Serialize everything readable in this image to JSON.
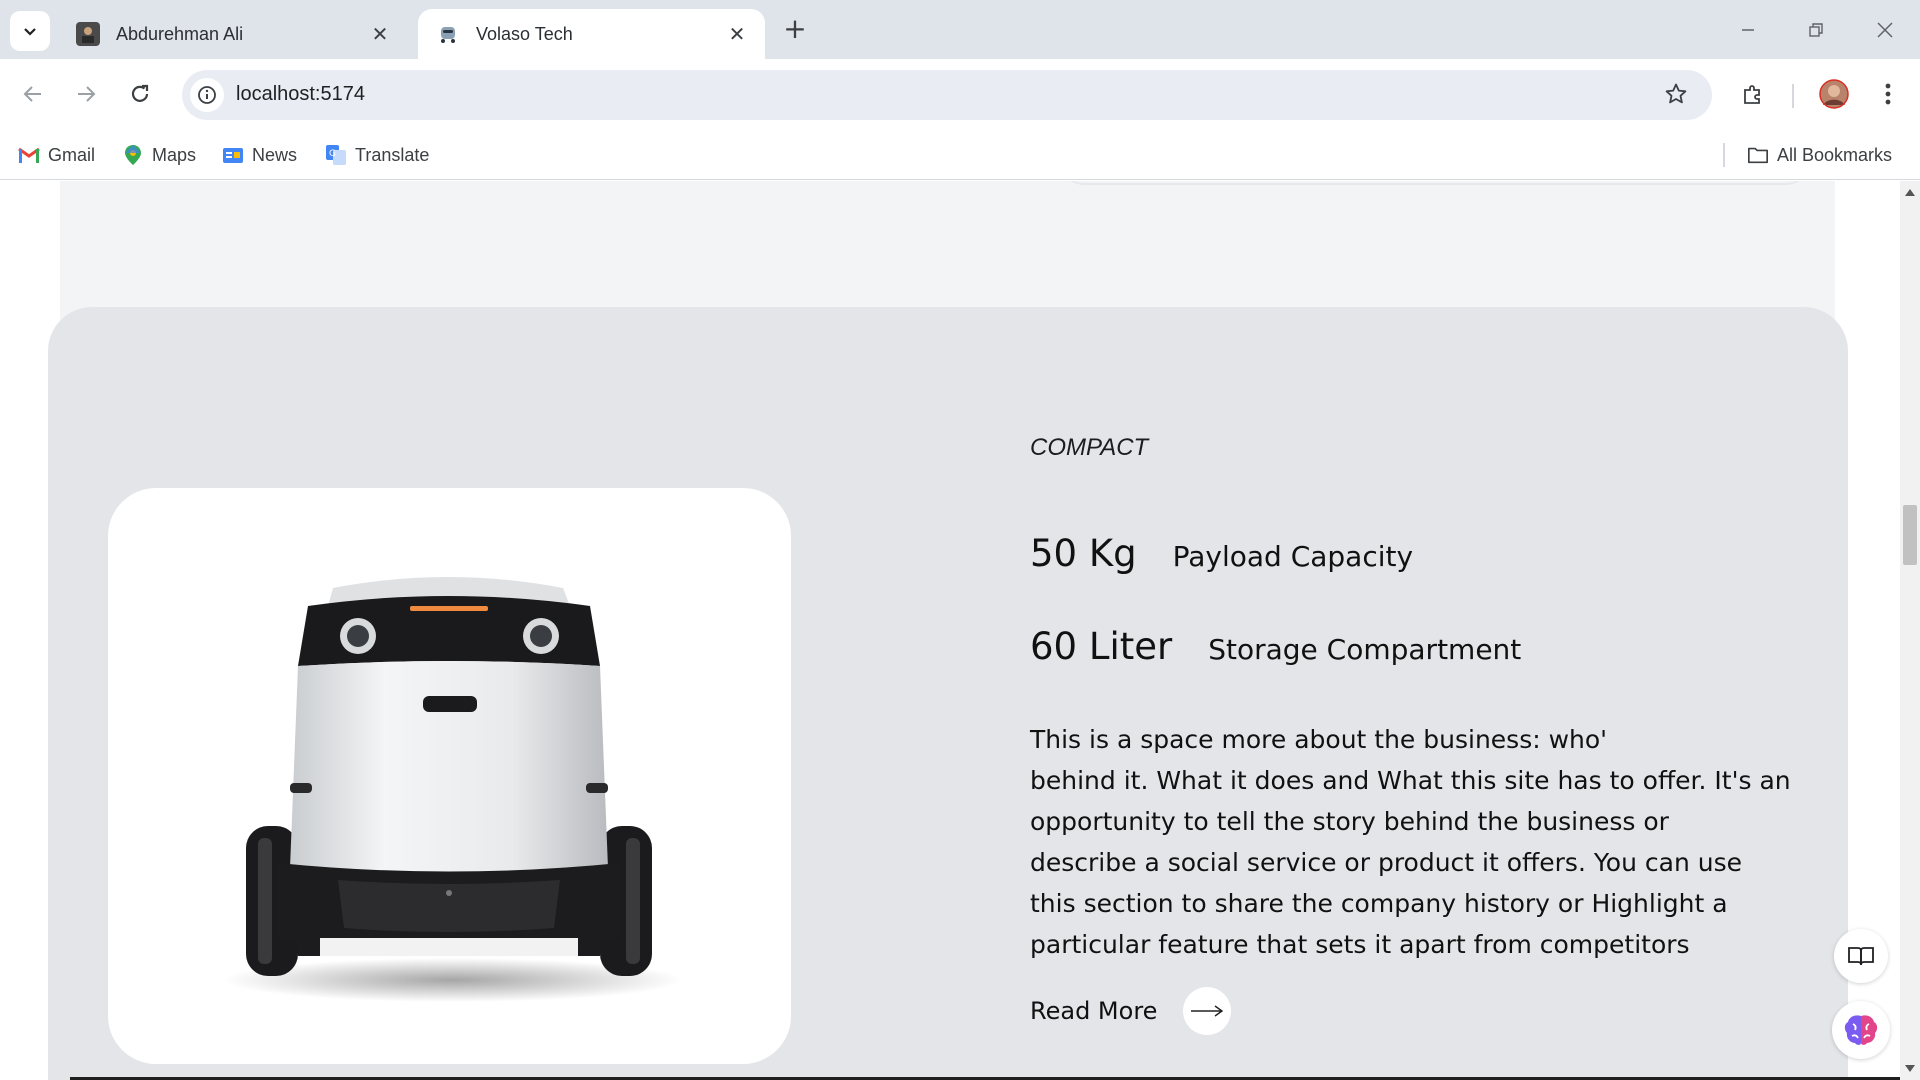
{
  "browser": {
    "tabs": [
      {
        "title": "Abdurehman Ali",
        "active": false
      },
      {
        "title": "Volaso Tech",
        "active": true
      }
    ],
    "url": "localhost:5174",
    "bookmarks": [
      {
        "label": "Gmail",
        "icon": "gmail-icon"
      },
      {
        "label": "Maps",
        "icon": "maps-icon"
      },
      {
        "label": "News",
        "icon": "news-icon"
      },
      {
        "label": "Translate",
        "icon": "translate-icon"
      }
    ],
    "all_bookmarks": "All Bookmarks"
  },
  "product": {
    "eyebrow": "COMPACT",
    "stats": [
      {
        "value": "50 Kg",
        "label": "Payload Capacity"
      },
      {
        "value": "60 Liter",
        "label": "Storage Compartment"
      }
    ],
    "description_lines": [
      "This is a space more about the business: who'",
      "behind it. What it does and What this site has to offer. It's an",
      "opportunity to tell the story behind the business or",
      "describe a social service or product it offers. You can use",
      "this section to share the company history or Highlight a",
      "particular feature that sets it apart from competitors"
    ],
    "read_more": "Read More",
    "image": "delivery-robot-image"
  },
  "colors": {
    "tabstrip": "#dfe3ea",
    "card": "#e4e5e9",
    "prev_card": "#f3f4f6"
  }
}
